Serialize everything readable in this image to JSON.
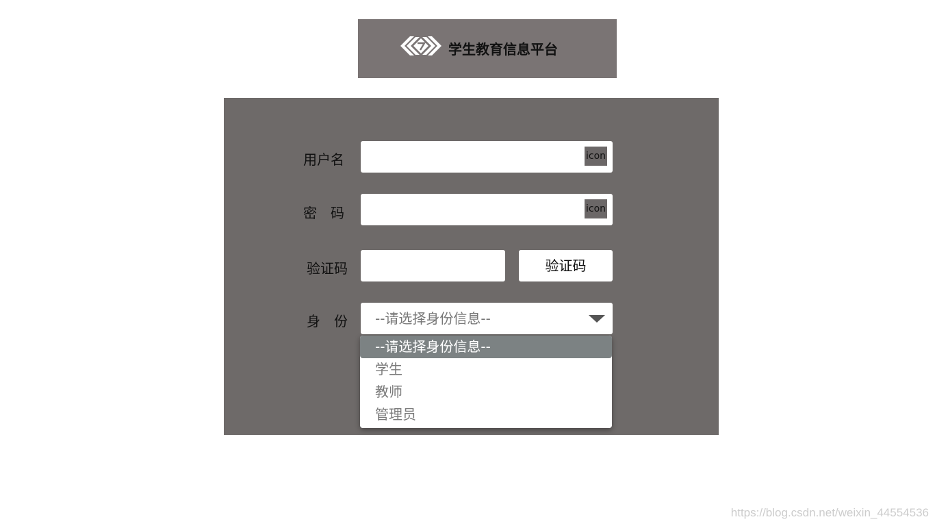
{
  "header": {
    "title": "学生教育信息平台",
    "logo_icon": "diamond-logo-icon"
  },
  "form": {
    "username_label": "用户名",
    "password_label": "密　码",
    "captcha_label": "验证码",
    "role_label": "身　份",
    "username_icon_text": "icon",
    "password_icon_text": "icon",
    "username_value": "",
    "password_value": "",
    "captcha_value": "",
    "captcha_button": "验证码",
    "role_selected": "--请选择身份信息--",
    "role_options": [
      "--请选择身份信息--",
      "学生",
      "教师",
      "管理员"
    ]
  },
  "watermark": "https://blog.csdn.net/weixin_44554536",
  "colors": {
    "header_bg": "#7a7474",
    "panel_bg": "#6e6a69",
    "selected_option_bg": "#7c8283"
  }
}
